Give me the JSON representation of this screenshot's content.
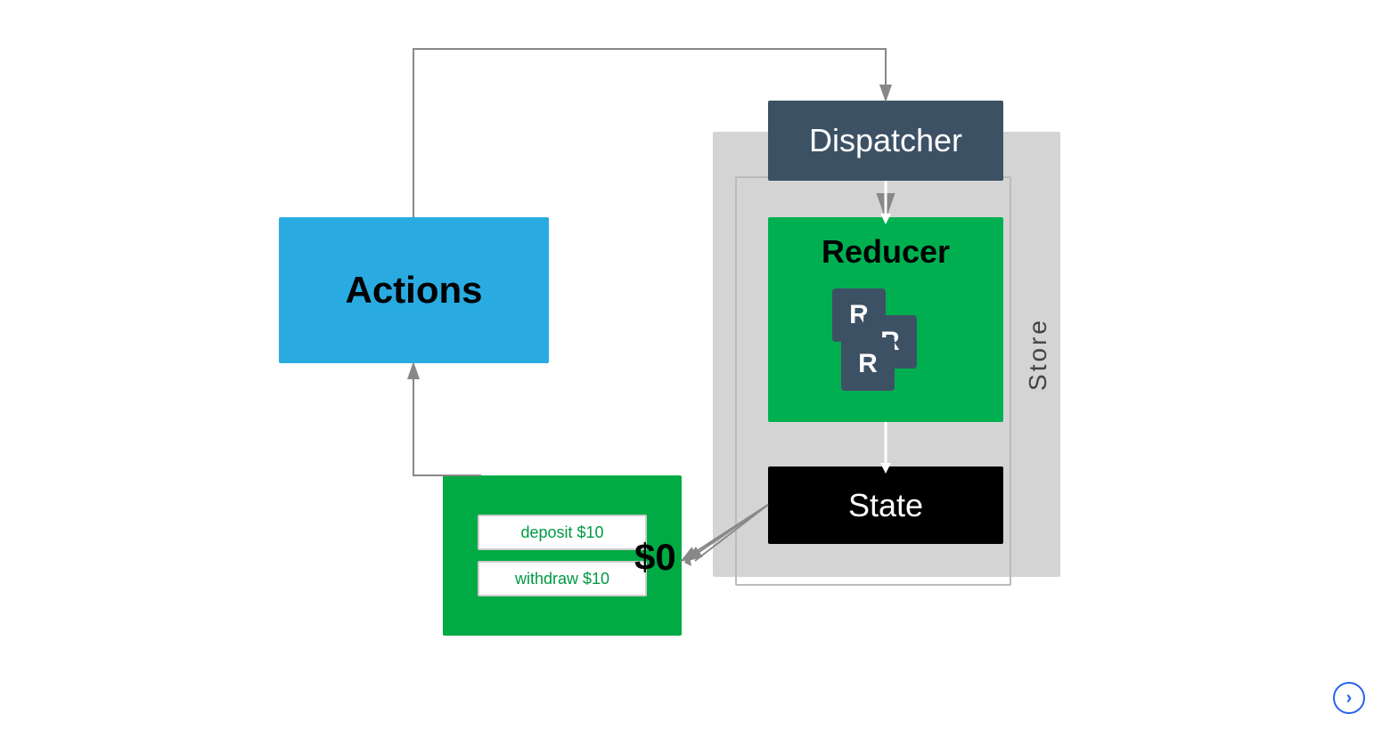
{
  "diagram": {
    "actions": {
      "label": "Actions",
      "bg_color": "#29ABE2"
    },
    "dispatcher": {
      "label": "Dispatcher",
      "bg_color": "#3d5165"
    },
    "reducer": {
      "label": "Reducer",
      "bg_color": "#00B050",
      "tiles": [
        "R",
        "R",
        "R"
      ]
    },
    "state": {
      "label": "State",
      "bg_color": "#000000"
    },
    "store": {
      "label": "Store",
      "bg_color": "#d4d4d4"
    },
    "ui": {
      "bg_color": "#00AA44",
      "buttons": [
        {
          "label": "deposit $10"
        },
        {
          "label": "withdraw $10"
        }
      ]
    },
    "dollar_value": "$0",
    "arrows": {
      "color": "#888"
    }
  },
  "brand": {
    "icon": "chevron-right"
  }
}
